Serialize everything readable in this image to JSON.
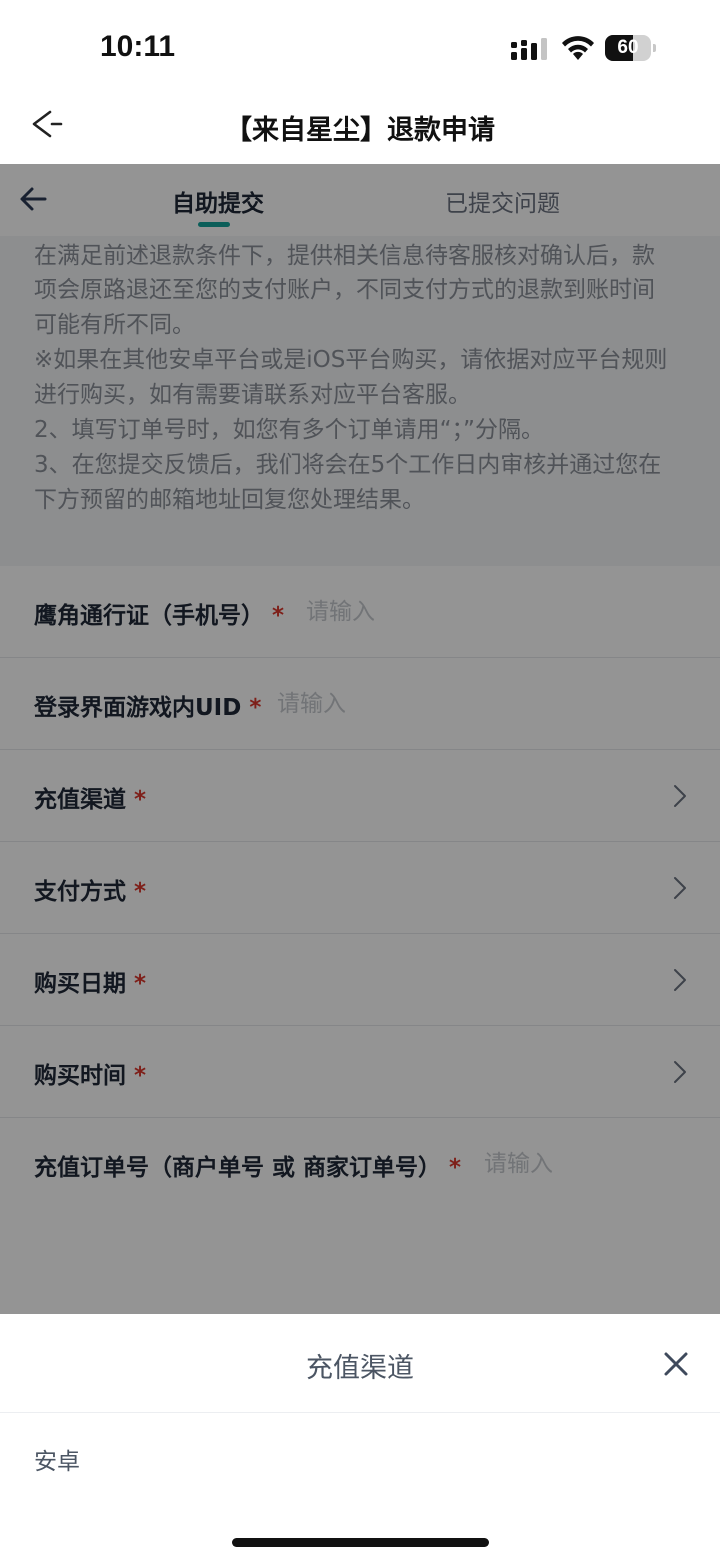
{
  "status_bar": {
    "time": "10:11",
    "battery_level": "60",
    "battery_fraction": 0.6
  },
  "header": {
    "title": "【来自星尘】退款申请",
    "back_icon": "back-icon"
  },
  "tabs": {
    "items": [
      {
        "label": "自助提交",
        "active": true
      },
      {
        "label": "已提交问题",
        "active": false
      }
    ],
    "accent_color": "#14a39a"
  },
  "notice": {
    "lines": [
      "在满足前述退款条件下，提供相关信息待客服核对确认后，款",
      "项会原路退还至您的支付账户，不同支付方式的退款到账时间",
      "可能有所不同。",
      "※如果在其他安卓平台或是iOS平台购买，请依据对应平台规则",
      "进行购买，如有需要请联系对应平台客服。",
      "2、填写订单号时，如您有多个订单请用“；”分隔。",
      "3、在您提交反馈后，我们将会在5个工作日内审核并通过您在",
      "下方预留的邮箱地址回复您处理结果。"
    ]
  },
  "form": {
    "required_mark": "*",
    "fields": [
      {
        "label": "鹰角通行证（手机号）",
        "placeholder": "请输入",
        "value": ""
      },
      {
        "label": "登录界面游戏内UID",
        "placeholder": "请输入",
        "value": ""
      },
      {
        "label": "充值渠道"
      },
      {
        "label": "支付方式"
      },
      {
        "label": "购买日期"
      },
      {
        "label": "购买时间"
      },
      {
        "label": "充值订单号（商户单号 或 商家订单号）",
        "placeholder": "请输入",
        "value": ""
      }
    ]
  },
  "sheet": {
    "title": "充值渠道",
    "close_icon": "close-icon",
    "options": [
      "安卓"
    ]
  },
  "colors": {
    "required": "#d9362b",
    "overlay": "rgba(0,0,0,0.42)"
  }
}
